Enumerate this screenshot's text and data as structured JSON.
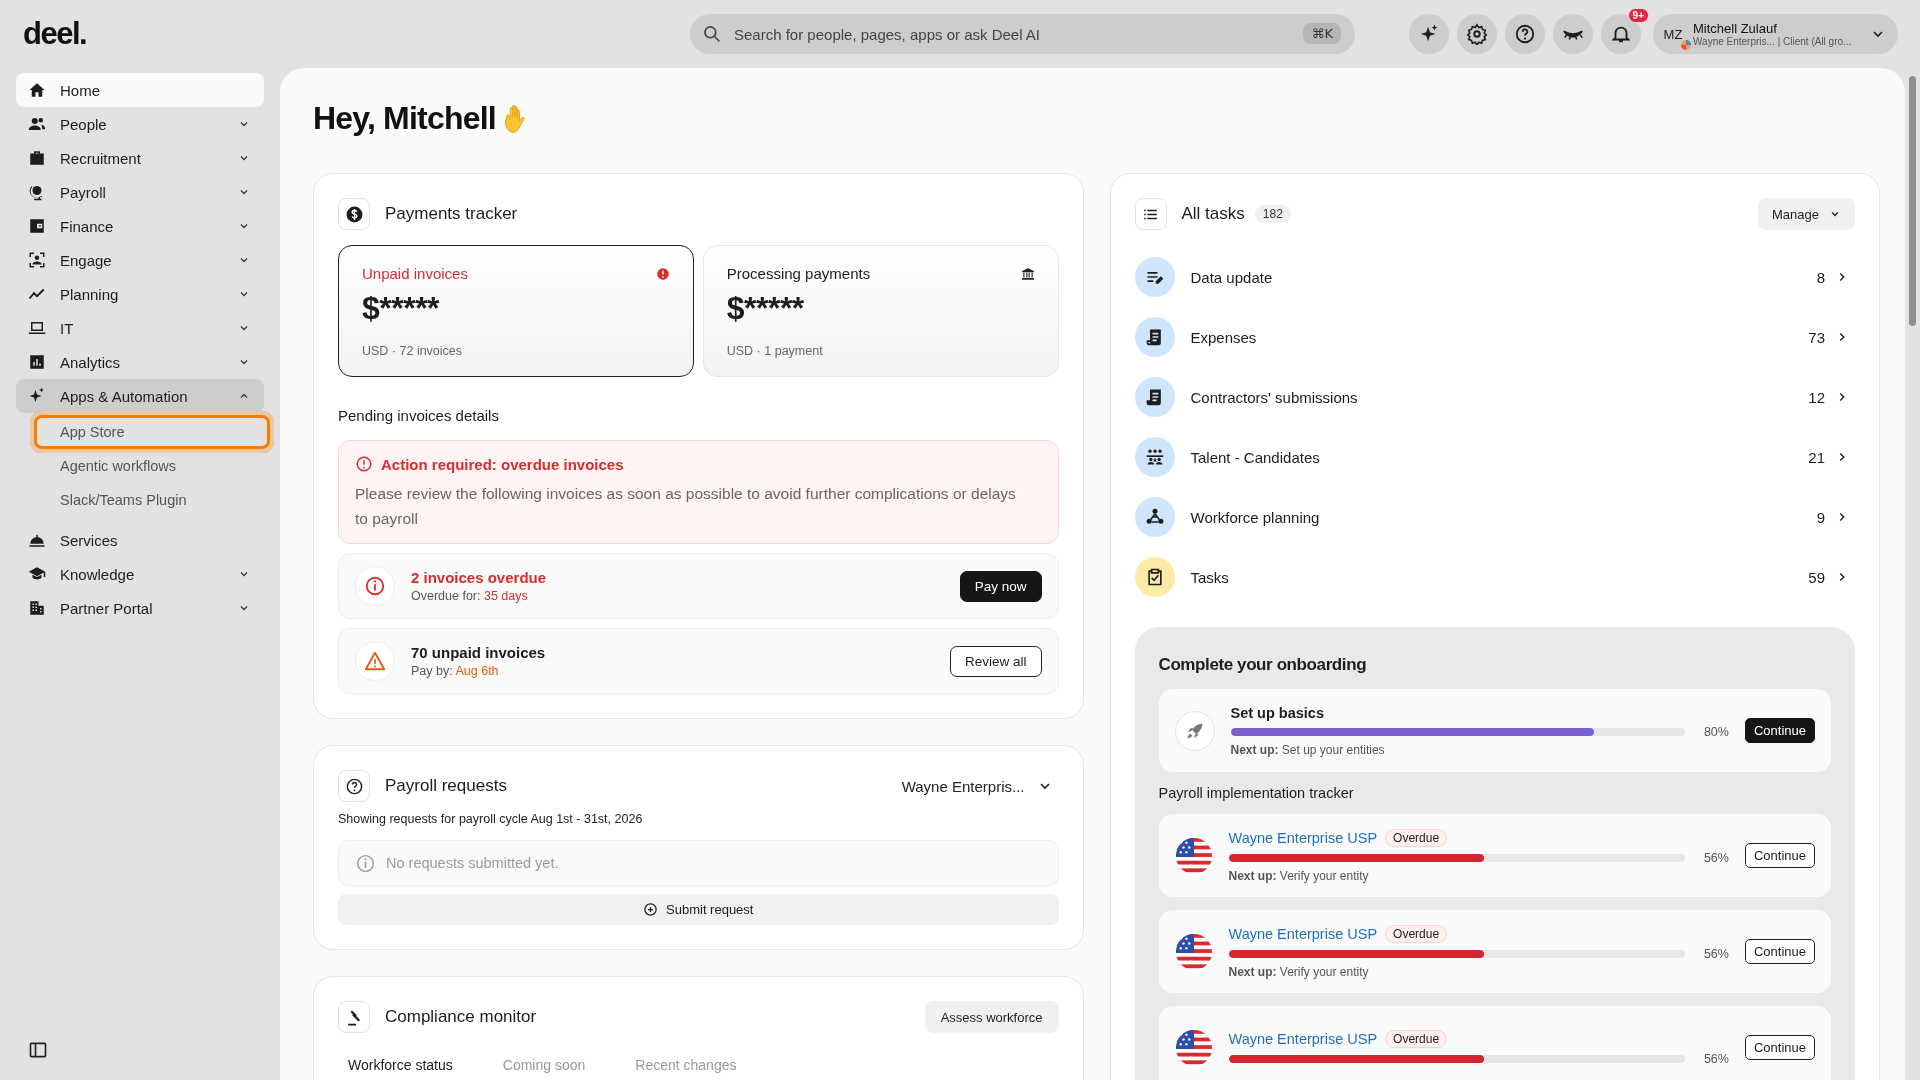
{
  "logo": "deel.",
  "search": {
    "placeholder": "Search for people, pages, apps or ask Deel AI",
    "shortcut": "⌘K"
  },
  "notifications_badge": "9+",
  "user": {
    "initials": "MZ",
    "name": "Mitchell Zulauf",
    "subtitle": "Wayne Enterpris... | Client (All gro..."
  },
  "sidebar": {
    "items": [
      {
        "label": "Home",
        "selected": true,
        "expandable": false
      },
      {
        "label": "People",
        "selected": false,
        "expandable": true,
        "expanded": false
      },
      {
        "label": "Recruitment",
        "selected": false,
        "expandable": true,
        "expanded": false
      },
      {
        "label": "Payroll",
        "selected": false,
        "expandable": true,
        "expanded": false
      },
      {
        "label": "Finance",
        "selected": false,
        "expandable": true,
        "expanded": false
      },
      {
        "label": "Engage",
        "selected": false,
        "expandable": true,
        "expanded": false
      },
      {
        "label": "Planning",
        "selected": false,
        "expandable": true,
        "expanded": false
      },
      {
        "label": "IT",
        "selected": false,
        "expandable": true,
        "expanded": false
      },
      {
        "label": "Analytics",
        "selected": false,
        "expandable": true,
        "expanded": false
      },
      {
        "label": "Apps & Automation",
        "selected": false,
        "expandable": true,
        "expanded": true,
        "children": [
          {
            "label": "App Store",
            "focused": true
          },
          {
            "label": "Agentic workflows",
            "focused": false
          },
          {
            "label": "Slack/Teams Plugin",
            "focused": false
          }
        ]
      },
      {
        "label": "Services",
        "selected": false,
        "expandable": false
      },
      {
        "label": "Knowledge",
        "selected": false,
        "expandable": true,
        "expanded": false
      },
      {
        "label": "Partner Portal",
        "selected": false,
        "expandable": true,
        "expanded": false
      }
    ]
  },
  "greeting": "Hey, Mitchell",
  "payments_tracker": {
    "title": "Payments tracker",
    "summary_cards": [
      {
        "title": "Unpaid invoices",
        "amount": "$*****",
        "meta": "USD · 72 invoices",
        "selected": true,
        "alert": true
      },
      {
        "title": "Processing payments",
        "amount": "$*****",
        "meta": "USD · 1 payment",
        "selected": false,
        "alert": false
      }
    ],
    "pending_title": "Pending invoices details",
    "alert": {
      "title": "Action required: overdue invoices",
      "text": "Please review the following invoices as soon as possible to avoid further complications or delays to payroll"
    },
    "invoice_rows": [
      {
        "kind": "overdue",
        "title": "2 invoices overdue",
        "detail_label": "Overdue for:",
        "detail_value": "35 days",
        "button": "Pay now"
      },
      {
        "kind": "warning",
        "title": "70 unpaid invoices",
        "detail_label": "Pay by:",
        "detail_value": "Aug 6th",
        "button": "Review all"
      }
    ]
  },
  "payroll_requests": {
    "title": "Payroll requests",
    "entity_select": "Wayne Enterpris...",
    "subtitle": "Showing requests for payroll cycle Aug 1st - 31st, 2026",
    "empty_text": "No requests submitted yet.",
    "button": "Submit request"
  },
  "compliance_monitor": {
    "title": "Compliance monitor",
    "button": "Assess workforce",
    "tabs": [
      {
        "label": "Workforce status",
        "selected": true
      },
      {
        "label": "Coming soon",
        "selected": false
      },
      {
        "label": "Recent changes",
        "selected": false
      }
    ]
  },
  "tasks": {
    "title": "All tasks",
    "count": "182",
    "manage": "Manage",
    "items": [
      {
        "label": "Data update",
        "count": "8",
        "color": "#cfe5fc"
      },
      {
        "label": "Expenses",
        "count": "73",
        "color": "#cfe5fc"
      },
      {
        "label": "Contractors' submissions",
        "count": "12",
        "color": "#cfe5fc"
      },
      {
        "label": "Talent - Candidates",
        "count": "21",
        "color": "#cfe5fc"
      },
      {
        "label": "Workforce planning",
        "count": "9",
        "color": "#cfe5fc"
      },
      {
        "label": "Tasks",
        "count": "59",
        "color": "#fdeaa6"
      }
    ]
  },
  "onboarding": {
    "title": "Complete your onboarding",
    "basics": {
      "title": "Set up basics",
      "level": 0.8,
      "percent": "80%",
      "next_label": "Next up:",
      "next_value": "Set up your entities",
      "button": "Continue"
    },
    "tracker_title": "Payroll implementation tracker",
    "entities": [
      {
        "name": "Wayne Enterprise USP",
        "status": "Overdue",
        "level": 0.56,
        "percent": "56%",
        "next_label": "Next up:",
        "next_value": "Verify your entity",
        "button": "Continue"
      },
      {
        "name": "Wayne Enterprise USP",
        "status": "Overdue",
        "level": 0.56,
        "percent": "56%",
        "next_label": "Next up:",
        "next_value": "Verify your entity",
        "button": "Continue"
      },
      {
        "name": "Wayne Enterprise USP",
        "status": "Overdue",
        "level": 0.56,
        "percent": "56%",
        "button": "Continue"
      }
    ]
  }
}
